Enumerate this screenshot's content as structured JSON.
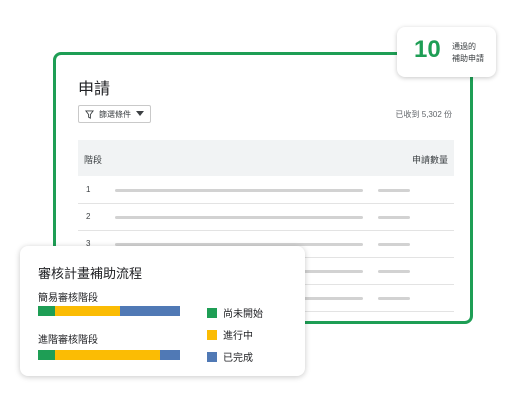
{
  "applications": {
    "title": "申請",
    "filter_label": "篩選條件",
    "received": "已收到 5,302 份",
    "columns": {
      "stage": "階段",
      "count": "申請數量"
    },
    "rows": [
      {
        "num": "1"
      },
      {
        "num": "2"
      },
      {
        "num": "3"
      },
      {
        "num": ""
      },
      {
        "num": ""
      }
    ]
  },
  "badge": {
    "number": "10",
    "line1": "通過的",
    "line2": "補助申請"
  },
  "flow": {
    "title": "審核計畫補助流程",
    "stages": [
      {
        "label": "簡易審核階段",
        "not_started": 0.12,
        "in_progress": 0.46,
        "done": 0.42
      },
      {
        "label": "進階審核階段",
        "not_started": 0.12,
        "in_progress": 0.74,
        "done": 0.14
      }
    ],
    "legend": {
      "not_started": "尚未開始",
      "in_progress": "進行中",
      "done": "已完成"
    }
  },
  "colors": {
    "green": "#1e9e55",
    "yellow": "#fbbc04",
    "blue": "#5079b5"
  }
}
